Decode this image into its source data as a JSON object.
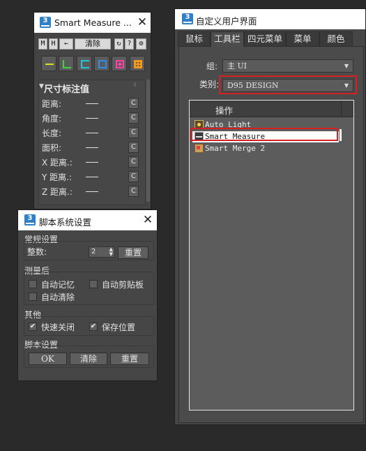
{
  "smart_measure": {
    "title": "Smart Measure ...",
    "toolbar": {
      "m": "M",
      "h": "H",
      "arrow": "←",
      "clear": "清除",
      "refresh": "↻",
      "help": "?",
      "settings": "⚙"
    },
    "tools": [
      "line-tool",
      "angle-tool",
      "length-tool",
      "area-tool",
      "add-tool",
      "grid-tool"
    ],
    "tool_colors": [
      "#d6e21a",
      "#3ed63e",
      "#22c8d8",
      "#2a8fe6",
      "#ff40a6",
      "#f29a1a"
    ],
    "section_title": "尺寸标注值",
    "rows": [
      {
        "label": "距离:",
        "value": "——",
        "btn": "C"
      },
      {
        "label": "角度:",
        "value": "——",
        "btn": "C"
      },
      {
        "label": "长度:",
        "value": "——",
        "btn": "C"
      },
      {
        "label": "面积:",
        "value": "——",
        "btn": "C"
      },
      {
        "label": "X 距离.:",
        "value": "——",
        "btn": "C"
      },
      {
        "label": "Y 距离.:",
        "value": "——",
        "btn": "C"
      },
      {
        "label": "Z 距离.:",
        "value": "——",
        "btn": "C"
      }
    ]
  },
  "script_settings": {
    "title": "脚本系统设置",
    "general": {
      "label": "常规设置",
      "int_label": "整数:",
      "int_value": "2",
      "reset": "重置"
    },
    "after_measure": {
      "label": "测量后",
      "auto_memory": "自动记忆",
      "auto_clipboard": "自动剪贴板",
      "auto_clear": "自动清除"
    },
    "other": {
      "label": "其他",
      "quick_close": "快速关闭",
      "save_position": "保存位置"
    },
    "script": {
      "label": "脚本设置",
      "ok": "OK",
      "clear": "清除",
      "reset": "重置"
    }
  },
  "customize_ui": {
    "title": "自定义用户界面",
    "tabs": [
      "鼠标",
      "工具栏",
      "四元菜单",
      "菜单",
      "颜色"
    ],
    "active_tab": 1,
    "group_label": "组:",
    "group_value": "主 UI",
    "category_label": "类别:",
    "category_value": "D95 DESIGN",
    "list_header": "操作",
    "actions": [
      "Auto Light",
      "Smart Measure",
      "Smart Merge 2"
    ],
    "highlight_color": "#d42020"
  }
}
